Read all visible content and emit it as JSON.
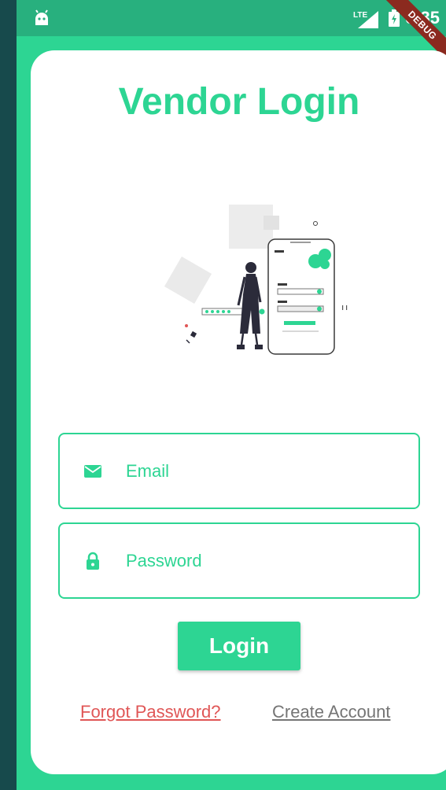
{
  "status_bar": {
    "time": "6:35",
    "network": "LTE",
    "debug_label": "DEBUG"
  },
  "page": {
    "title": "Vendor Login"
  },
  "form": {
    "email_placeholder": "Email",
    "password_placeholder": "Password",
    "login_label": "Login"
  },
  "links": {
    "forgot_password": "Forgot Password?",
    "create_account": "Create Account"
  },
  "icons": {
    "email": "mail-icon",
    "password": "lock-icon",
    "status": "android-icon"
  },
  "colors": {
    "accent": "#2dd593",
    "status_bar": "#28b07e",
    "link_warning": "#e05656",
    "link_secondary": "#757575",
    "debug_ribbon": "#8b2a1f"
  }
}
